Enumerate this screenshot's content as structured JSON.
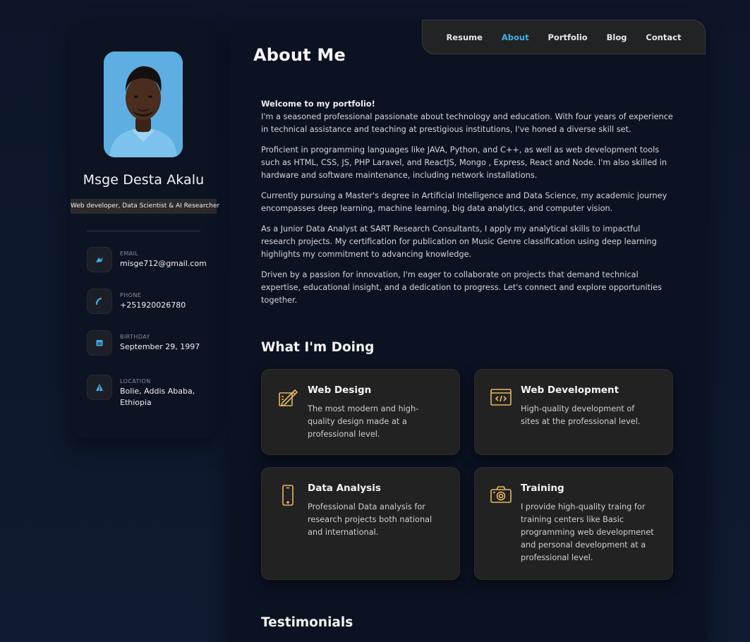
{
  "sidebar": {
    "name": "Msge Desta Akalu",
    "title": "Web developer, Data Scientist & AI Researcher",
    "contacts": [
      {
        "label": "EMAIL",
        "value": "misge712@gmail.com",
        "icon": "mail-icon"
      },
      {
        "label": "PHONE",
        "value": "+251920026780",
        "icon": "phone-icon"
      },
      {
        "label": "BIRTHDAY",
        "value": "September 29, 1997",
        "icon": "calendar-icon"
      },
      {
        "label": "LOCATION",
        "value": "Bolie, Addis Ababa, Ethiopia",
        "icon": "location-icon"
      }
    ]
  },
  "nav": {
    "items": [
      "Resume",
      "About",
      "Portfolio",
      "Blog",
      "Contact"
    ],
    "active": "About"
  },
  "about": {
    "title": "About Me",
    "welcome": "Welcome to my portfolio!",
    "paragraphs": [
      "I'm a seasoned professional passionate about technology and education. With four years of experience in technical assistance and teaching at prestigious institutions, I've honed a diverse skill set.",
      "Proficient in programming languages like JAVA, Python, and C++, as well as web development tools such as HTML, CSS, JS, PHP Laravel, and ReactJS, Mongo , Express, React and Node. I'm also skilled in hardware and software maintenance, including network installations.",
      "Currently pursuing a Master's degree in Artificial Intelligence and Data Science, my academic journey encompasses deep learning, machine learning, big data analytics, and computer vision.",
      "As a Junior Data Analyst at SART Research Consultants, I apply my analytical skills to impactful research projects. My certification for publication on Music Genre classification using deep learning highlights my commitment to advancing knowledge.",
      "Driven by a passion for innovation, I'm eager to collaborate on projects that demand technical expertise, educational insight, and a dedication to progress. Let's connect and explore opportunities together."
    ]
  },
  "services": {
    "title": "What I'm Doing",
    "items": [
      {
        "title": "Web Design",
        "text": "The most modern and high-quality design made at a professional level.",
        "icon": "design-icon"
      },
      {
        "title": "Web Development",
        "text": "High-quality development of sites at the professional level.",
        "icon": "code-icon"
      },
      {
        "title": "Data Analysis",
        "text": "Professional Data analysis for research projects both national and international.",
        "icon": "mobile-icon"
      },
      {
        "title": "Training",
        "text": "I provide high-quality traing for training centers like Basic programming web developmenet and personal development at a professional level.",
        "icon": "camera-icon"
      }
    ]
  },
  "testimonials": {
    "title": "Testimonials"
  },
  "colors": {
    "accent": "#3eb0e8",
    "icon_gold": "#e6b85c",
    "background": "#0d1629"
  }
}
